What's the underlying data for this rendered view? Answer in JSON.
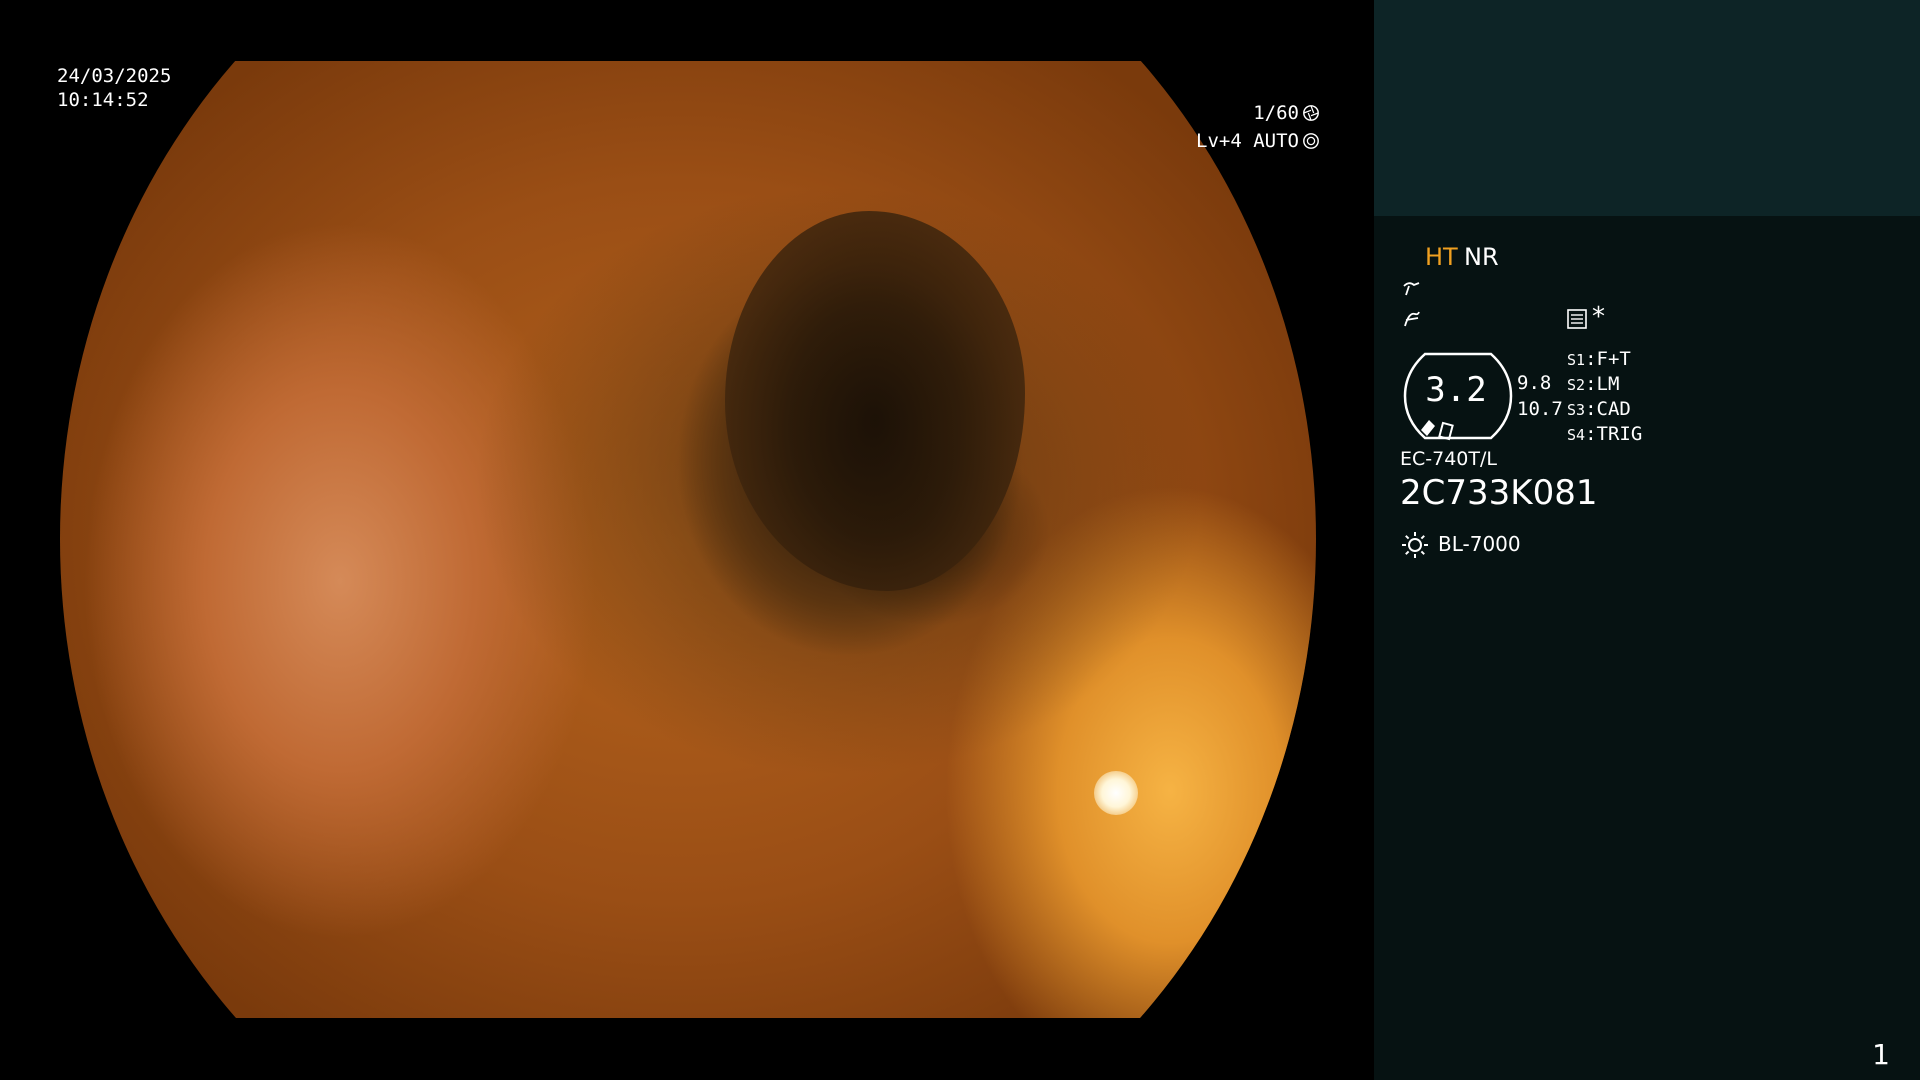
{
  "overlay": {
    "date": "24/03/2025",
    "time": "10:14:52",
    "shutter": "1/60",
    "shutter_icon": "shutter-icon",
    "exposure": "Lv+4 AUTO",
    "exposure_icon": "iris-icon"
  },
  "colors": {
    "panel_top": "#0d2426",
    "panel": "#061212",
    "accent": "#f0a020"
  },
  "panel": {
    "mode_ht": "HT",
    "mode_nr": "NR",
    "icons": [
      "enhancement-icon",
      "structure-icon",
      "record-icon"
    ],
    "star": "*",
    "lens_value": "3.2",
    "zoom_upper": "9.8",
    "zoom_lower": "10.7",
    "switches": [
      {
        "key": "S1",
        "label": "F+T"
      },
      {
        "key": "S2",
        "label": "LM"
      },
      {
        "key": "S3",
        "label": "CAD"
      },
      {
        "key": "S4",
        "label": "TRIG"
      }
    ],
    "scope_model": "EC-740T/L",
    "serial": "2C733K081",
    "light_source": "BL-7000",
    "page_number": "1"
  }
}
